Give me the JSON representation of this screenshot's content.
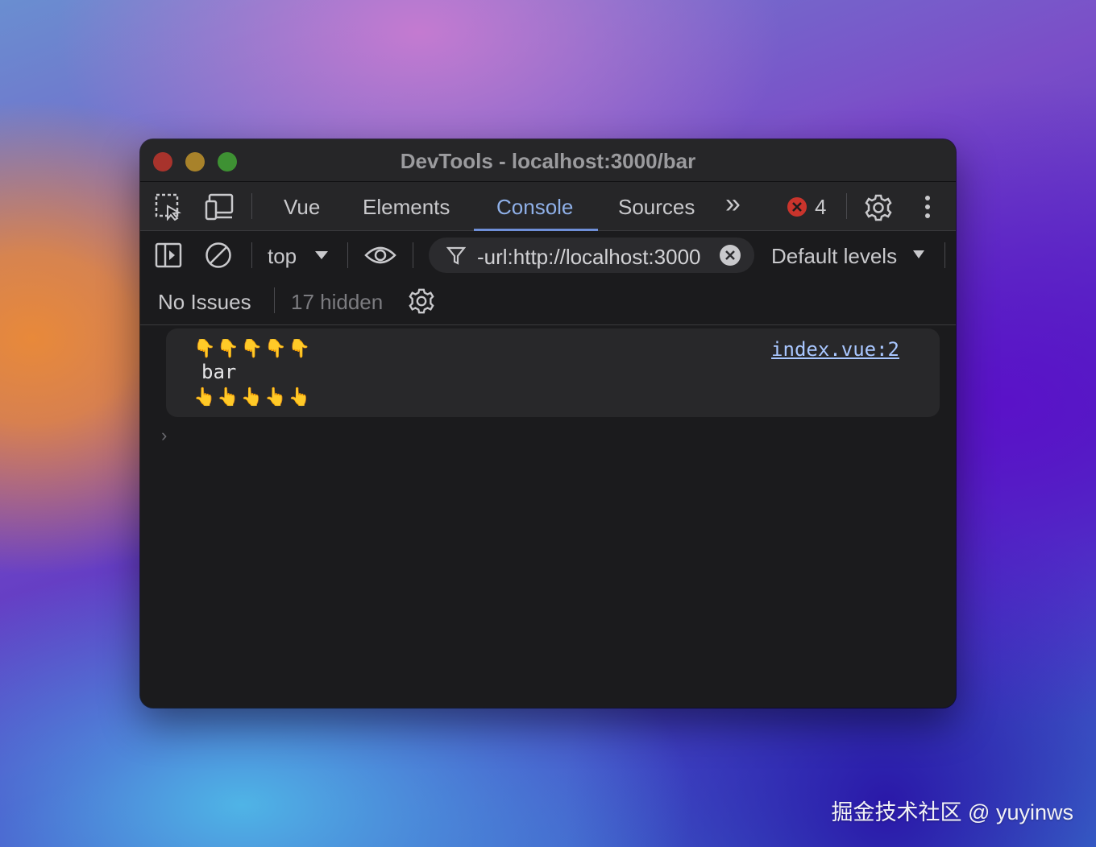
{
  "window": {
    "title": "DevTools - localhost:3000/bar"
  },
  "tabs": [
    {
      "label": "Vue"
    },
    {
      "label": "Elements"
    },
    {
      "label": "Console",
      "active": true
    },
    {
      "label": "Sources"
    }
  ],
  "tabbar": {
    "more_glyph": "»",
    "error_count": "4"
  },
  "console_toolbar": {
    "context": "top",
    "filter_value": "-url:http://localhost:3000",
    "levels": "Default levels"
  },
  "issues_bar": {
    "issues": "No Issues",
    "hidden": "17 hidden"
  },
  "messages": [
    {
      "prefix": "👇👇👇👇👇",
      "text": "bar",
      "suffix": "👆👆👆👆👆",
      "source": "index.vue:2"
    }
  ],
  "prompt_glyph": "›",
  "watermark": "掘金技术社区 @ yuyinws",
  "colors": {
    "accent": "#8fb0e8",
    "error": "#c9342c",
    "link": "#a9c7ff"
  }
}
